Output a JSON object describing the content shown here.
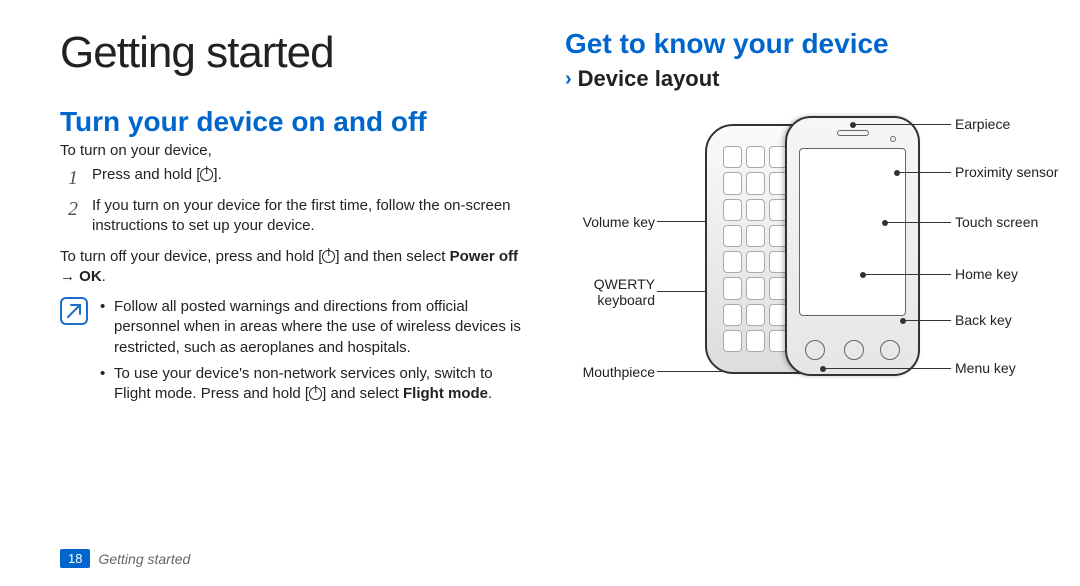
{
  "left": {
    "title": "Getting started",
    "h2_turn": "Turn your device on and off",
    "intro_on": "To turn on your device,",
    "step1": "Press and hold [",
    "step1b": "].",
    "step2": "If you turn on your device for the first time, follow the on-screen instructions to set up your device.",
    "off_para_a": "To turn off your device, press and hold [",
    "off_para_b": "] and then select ",
    "off_bold": "Power off → OK",
    "off_para_c": ".",
    "note1": "Follow all posted warnings and directions from official personnel when in areas where the use of wireless devices is restricted, such as aeroplanes and hospitals.",
    "note2_a": "To use your device's non-network services only, switch to Flight mode. Press and hold [",
    "note2_b": "] and select ",
    "note2_bold": "Flight mode",
    "note2_c": "."
  },
  "right": {
    "h2_get": "Get to know your device",
    "subhead": "Device layout",
    "labels": {
      "volume": "Volume key",
      "qwerty_a": "QWERTY",
      "qwerty_b": "keyboard",
      "mouth": "Mouthpiece",
      "ear": "Earpiece",
      "prox": "Proximity sensor",
      "touch": "Touch screen",
      "home": "Home key",
      "back": "Back key",
      "menu": "Menu key"
    }
  },
  "footer": {
    "page": "18",
    "section": "Getting started"
  }
}
